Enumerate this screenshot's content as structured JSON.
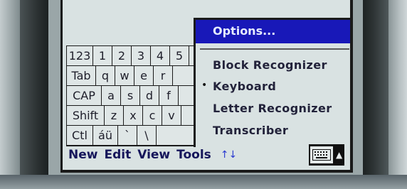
{
  "keyboard": {
    "rows": [
      [
        "123",
        "1",
        "2",
        "3",
        "4",
        "5"
      ],
      [
        "Tab",
        "q",
        "w",
        "e",
        "r"
      ],
      [
        "CAP",
        "a",
        "s",
        "d",
        "f"
      ],
      [
        "Shift",
        "z",
        "x",
        "c",
        "v"
      ],
      [
        "Ctl",
        "áü",
        "`",
        "\\"
      ]
    ]
  },
  "menubar": {
    "items": [
      "New",
      "Edit",
      "View",
      "Tools"
    ],
    "arrow": "↑↓"
  },
  "options_menu": {
    "header": "Options...",
    "items": [
      "Block Recognizer",
      "Keyboard",
      "Letter Recognizer",
      "Transcriber"
    ],
    "selected": "Keyboard",
    "bullet": "•"
  },
  "sip": {
    "up_arrow": "▲"
  }
}
